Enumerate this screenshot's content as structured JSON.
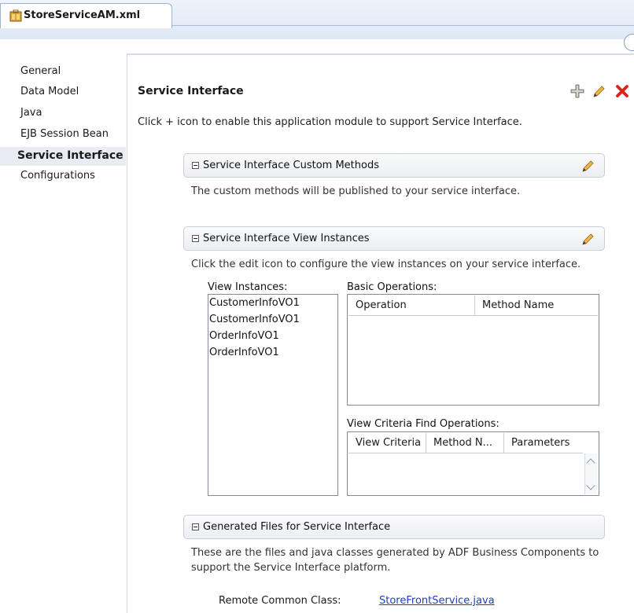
{
  "tab": {
    "file_name": "StoreServiceAM.xml"
  },
  "nav": {
    "items": [
      {
        "label": "General"
      },
      {
        "label": "Data Model"
      },
      {
        "label": "Java"
      },
      {
        "label": "EJB Session Bean"
      },
      {
        "label": "Service Interface",
        "selected": true
      },
      {
        "label": "Configurations"
      }
    ]
  },
  "main": {
    "title": "Service Interface",
    "description": "Click + icon to enable this application module to support Service Interface.",
    "toolbar_icons": [
      "plus-icon",
      "edit-pencil-icon",
      "delete-x-icon"
    ],
    "custom_methods": {
      "header": "Service Interface Custom Methods",
      "description": "The custom methods will be published to your service interface."
    },
    "view_instances_group": {
      "header": "Service Interface View Instances",
      "description": "Click the edit icon to configure the view instances on your service interface.",
      "view_instances_label": "View Instances:",
      "view_instances": [
        "CustomerInfoVO1",
        "CustomerInfoVO1",
        "OrderInfoVO1",
        "OrderInfoVO1"
      ],
      "basic_operations_label": "Basic Operations:",
      "basic_operations_columns": [
        "Operation",
        "Method Name"
      ],
      "view_criteria_label": "View Criteria Find Operations:",
      "view_criteria_columns": [
        "View Criteria",
        "Method N...",
        "Parameters"
      ]
    },
    "generated_files": {
      "header": "Generated Files for Service Interface",
      "description_line1": "These are the files and java classes generated by ADF Business Components to",
      "description_line2": "support the Service Interface platform.",
      "remote_label": "Remote Common Class:",
      "remote_link": "StoreFrontService.java"
    }
  },
  "colors": {
    "accent_link": "#1f3fb5",
    "delete_red": "#d8261e",
    "pencil_orange": "#e8a030"
  }
}
